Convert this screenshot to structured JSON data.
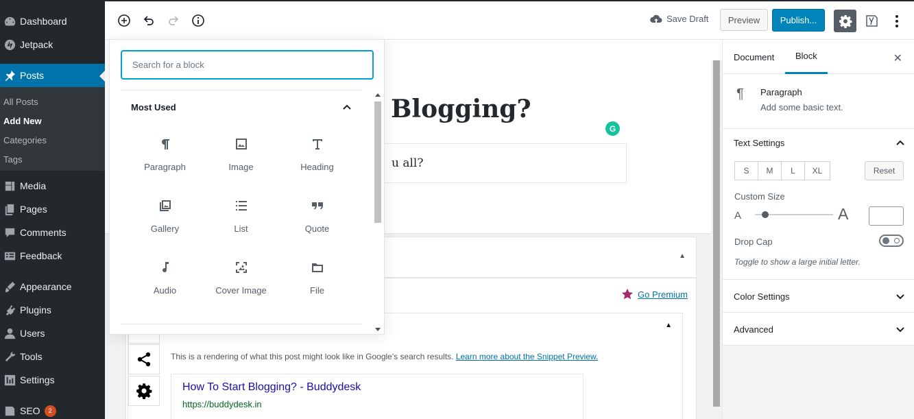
{
  "admin_menu": {
    "items": [
      {
        "label": "Dashboard",
        "icon": "dashboard-icon"
      },
      {
        "label": "Jetpack",
        "icon": "jetpack-icon"
      },
      {
        "label": "Posts",
        "icon": "pin-icon",
        "active": true
      },
      {
        "label": "Media",
        "icon": "media-icon"
      },
      {
        "label": "Pages",
        "icon": "pages-icon"
      },
      {
        "label": "Comments",
        "icon": "comments-icon"
      },
      {
        "label": "Feedback",
        "icon": "feedback-icon"
      },
      {
        "label": "Appearance",
        "icon": "appearance-icon"
      },
      {
        "label": "Plugins",
        "icon": "plugins-icon"
      },
      {
        "label": "Users",
        "icon": "users-icon"
      },
      {
        "label": "Tools",
        "icon": "tools-icon"
      },
      {
        "label": "Settings",
        "icon": "settings-icon"
      },
      {
        "label": "SEO",
        "icon": "yoast-icon",
        "badge": "2"
      }
    ],
    "posts_submenu": [
      "All Posts",
      "Add New",
      "Categories",
      "Tags"
    ],
    "current_submenu": "Add New"
  },
  "toolbar": {
    "save_draft": "Save Draft",
    "preview": "Preview",
    "publish": "Publish..."
  },
  "editor": {
    "title_visible": "Blogging?",
    "paragraph_visible": "u all?",
    "grammarly": "G",
    "go_premium": "Go Premium",
    "snippet_description": "This is a rendering of what this post might look like in Google's search results.",
    "snippet_link": "Learn more about the Snippet Preview.",
    "snippet_title": "How To Start Blogging? - Buddydesk",
    "snippet_url": "https://buddydesk.in"
  },
  "inserter": {
    "search_placeholder": "Search for a block",
    "panel_title": "Most Used",
    "blocks": [
      {
        "label": "Paragraph",
        "icon": "paragraph-icon"
      },
      {
        "label": "Image",
        "icon": "image-icon"
      },
      {
        "label": "Heading",
        "icon": "heading-icon"
      },
      {
        "label": "Gallery",
        "icon": "gallery-icon"
      },
      {
        "label": "List",
        "icon": "list-icon"
      },
      {
        "label": "Quote",
        "icon": "quote-icon"
      },
      {
        "label": "Audio",
        "icon": "audio-icon"
      },
      {
        "label": "Cover Image",
        "icon": "cover-image-icon"
      },
      {
        "label": "File",
        "icon": "file-icon"
      }
    ]
  },
  "sidebar": {
    "tabs": [
      "Document",
      "Block"
    ],
    "active_tab": "Block",
    "block_card": {
      "title": "Paragraph",
      "description": "Add some basic text."
    },
    "text_settings": {
      "title": "Text Settings",
      "sizes": [
        "S",
        "M",
        "L",
        "XL"
      ],
      "reset": "Reset",
      "custom_size_label": "Custom Size",
      "small_a": "A",
      "big_a": "A",
      "slider_level": 0.1,
      "drop_cap_label": "Drop Cap",
      "drop_cap_help": "Toggle to show a large initial letter.",
      "drop_cap_on": false
    },
    "color_settings": "Color Settings",
    "advanced": "Advanced"
  },
  "colors": {
    "admin_bg": "#23282d",
    "admin_active": "#0073aa",
    "publish": "#0085ba",
    "search_focus": "#00a0d2",
    "snippet_title": "#1a0dab",
    "snippet_url": "#006621"
  }
}
